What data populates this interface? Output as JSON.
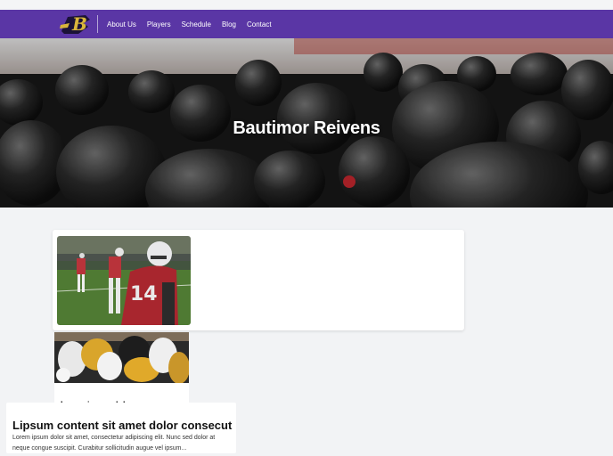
{
  "brand": {
    "logo_letter": "B",
    "accent": "#5a36a5",
    "logo_gold": "#d9b63c"
  },
  "nav": {
    "items": [
      {
        "label": "About Us"
      },
      {
        "label": "Players"
      },
      {
        "label": "Schedule"
      },
      {
        "label": "Blog"
      },
      {
        "label": "Contact"
      }
    ]
  },
  "hero": {
    "title": "Bautimor Reivens",
    "image": "football-team-huddle-photo"
  },
  "feature": {
    "image": "football-player-red-jersey-14-photo"
  },
  "post": {
    "image": "football-tackle-photo",
    "title": "Lorem ipsum dolor"
  },
  "article": {
    "heading": "Lipsum content sit amet dolor consecut",
    "body": "Lorem ipsum dolor sit amet, consectetur adipiscing elit. Nunc sed dolor at neque congue suscipit. Curabitur sollicitudin augue vel ipsum..."
  }
}
